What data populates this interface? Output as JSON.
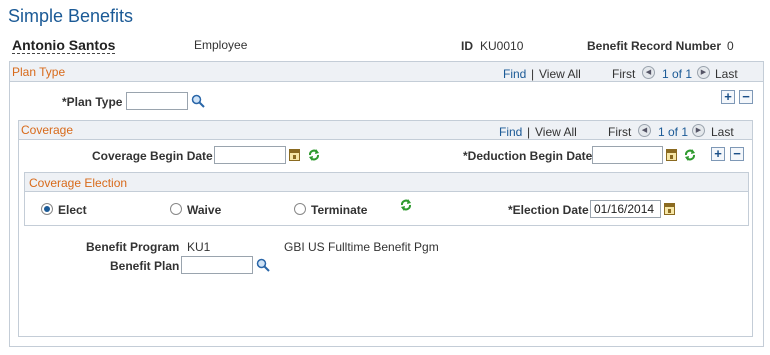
{
  "page": {
    "title": "Simple Benefits"
  },
  "header": {
    "employee_name": "Antonio Santos",
    "employee_type": "Employee",
    "id_label": "ID",
    "id_value": "KU0010",
    "record_label": "Benefit Record Number",
    "record_value": "0"
  },
  "plan_type": {
    "section_title": "Plan Type",
    "find": "Find",
    "separator": "|",
    "view_all": "View All",
    "first": "First",
    "pagination": "1 of 1",
    "last": "Last",
    "field_label": "*Plan Type",
    "field_value": "",
    "add": "+",
    "remove": "−"
  },
  "coverage": {
    "section_title": "Coverage",
    "find": "Find",
    "separator": "|",
    "view_all": "View All",
    "first": "First",
    "pagination": "1 of 1",
    "last": "Last",
    "begin_date_label": "Coverage Begin Date",
    "begin_date_value": "",
    "deduction_date_label": "*Deduction Begin Date",
    "deduction_date_value": "",
    "add": "+",
    "remove": "−"
  },
  "election": {
    "section_title": "Coverage Election",
    "options": [
      "Elect",
      "Waive",
      "Terminate"
    ],
    "selected": "Elect",
    "election_date_label": "*Election Date",
    "election_date_value": "01/16/2014"
  },
  "benefit": {
    "program_label": "Benefit Program",
    "program_code": "KU1",
    "program_desc": "GBI US Fulltime Benefit Pgm",
    "plan_label": "Benefit Plan",
    "plan_value": ""
  },
  "colors": {
    "title": "#1b5a96",
    "section_title": "#d86a1a",
    "link": "#1b5a96",
    "header_bg": "#eef1f5"
  },
  "icons": [
    "search-icon",
    "calendar-icon",
    "refresh-icon",
    "prev-arrow-icon",
    "next-arrow-icon"
  ]
}
